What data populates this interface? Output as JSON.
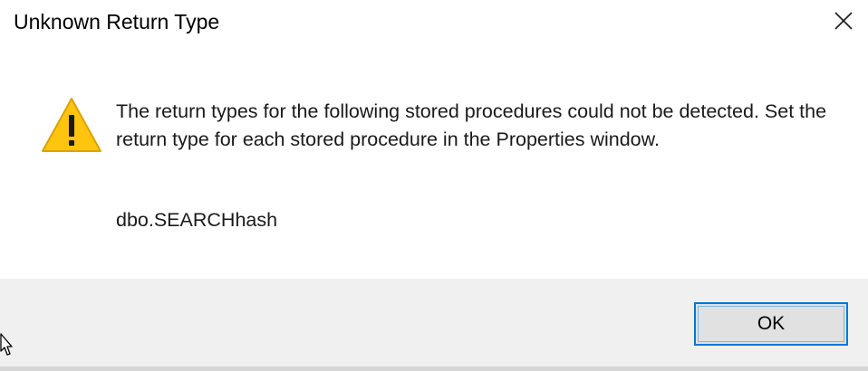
{
  "dialog": {
    "title": "Unknown Return Type",
    "message": "The return types for the following stored procedures could not be detected. Set the return type for each stored procedure in the Properties window.",
    "procedure_name": "dbo.SEARCHhash",
    "ok_label": "OK"
  },
  "icons": {
    "warning": "warning-icon",
    "close": "close-icon",
    "cursor": "mouse-cursor-icon"
  },
  "colors": {
    "warning_fill": "#ffc40d",
    "warning_stroke": "#d9a300",
    "accent_border": "#0078d7",
    "footer_background": "#f0f0f0"
  }
}
